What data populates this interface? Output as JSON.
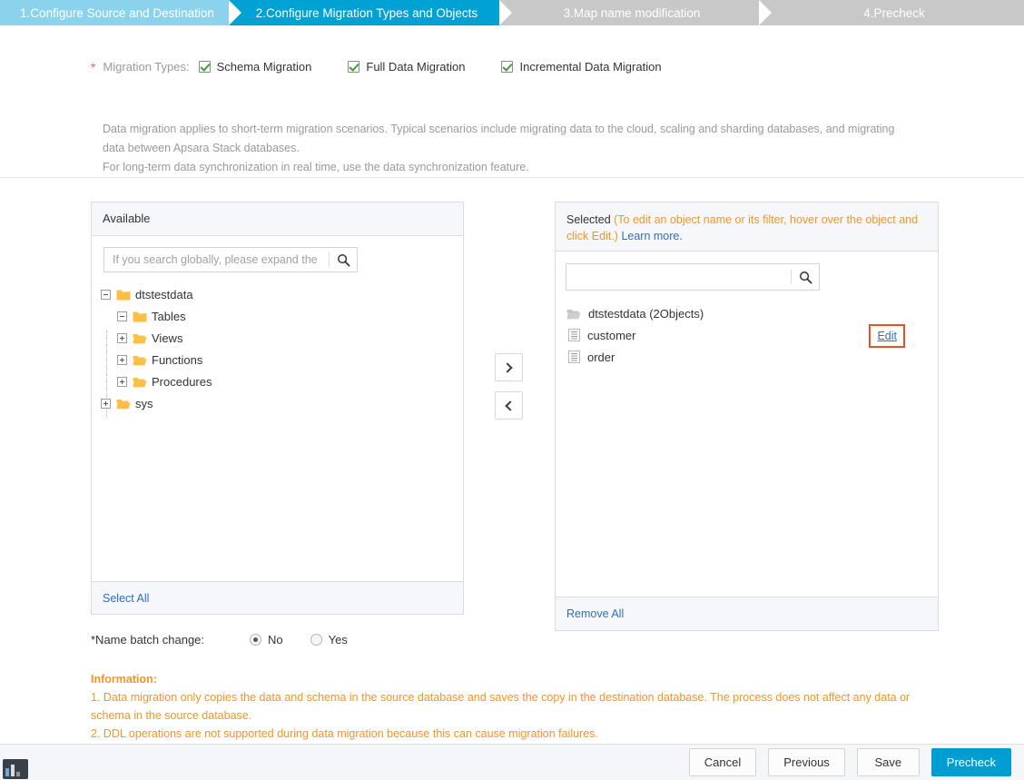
{
  "steps": [
    {
      "label": "1.Configure Source and Destination",
      "state": "done"
    },
    {
      "label": "2.Configure Migration Types and Objects",
      "state": "active"
    },
    {
      "label": "3.Map name modification",
      "state": "todo"
    },
    {
      "label": "4.Precheck",
      "state": "todo"
    }
  ],
  "migration": {
    "required_marker": "*",
    "label": "Migration Types:",
    "types": [
      {
        "label": "Schema Migration",
        "checked": true
      },
      {
        "label": "Full Data Migration",
        "checked": true
      },
      {
        "label": "Incremental Data Migration",
        "checked": true
      }
    ],
    "description_line1": "Data migration applies to short-term migration scenarios. Typical scenarios include migrating data to the cloud, scaling and sharding databases, and migrating data between Apsara Stack databases.",
    "description_line2": "For long-term data synchronization in real time, use the data synchronization feature."
  },
  "available": {
    "title": "Available",
    "search_placeholder": "If you search globally, please expand the ",
    "search_value": "",
    "search_icon": "search-icon",
    "tree": [
      {
        "label": "dtstestdata",
        "level": 1,
        "expanded": true,
        "toggle": "minus"
      },
      {
        "label": "Tables",
        "level": 2,
        "expanded": true,
        "toggle": "minus"
      },
      {
        "label": "Views",
        "level": 2,
        "expanded": false,
        "toggle": "plus"
      },
      {
        "label": "Functions",
        "level": 2,
        "expanded": false,
        "toggle": "plus"
      },
      {
        "label": "Procedures",
        "level": 2,
        "expanded": false,
        "toggle": "plus"
      },
      {
        "label": "sys",
        "level": 1,
        "expanded": false,
        "toggle": "plus"
      }
    ],
    "select_all": "Select All"
  },
  "transfer": {
    "move_right": "›",
    "move_left": "‹"
  },
  "selected": {
    "title": "Selected",
    "note": "(To edit an object name or its filter, hover over the object and click Edit.)",
    "learn_more": "Learn more.",
    "search_placeholder": "",
    "search_value": "",
    "search_icon": "search-icon",
    "items": [
      {
        "label": "dtstestdata (2Objects)",
        "icon": "folder-icon",
        "type": "group",
        "edit": null
      },
      {
        "label": "customer",
        "icon": "table-icon",
        "type": "object",
        "edit": "Edit"
      },
      {
        "label": "order",
        "icon": "table-icon",
        "type": "object",
        "edit": null
      }
    ],
    "remove_all": "Remove All",
    "highlight_color": "#e8512b"
  },
  "batch": {
    "label": "*Name batch change:",
    "options": [
      {
        "label": "No",
        "selected": true
      },
      {
        "label": "Yes",
        "selected": false
      }
    ]
  },
  "information": {
    "title": "Information:",
    "line1": "1. Data migration only copies the data and schema in the source database and saves the copy in the destination database. The process does not affect any data or schema in the source database.",
    "line2": "2. DDL operations are not supported during data migration because this can cause migration failures."
  },
  "footer": {
    "cancel": "Cancel",
    "previous": "Previous",
    "save": "Save",
    "precheck": "Precheck"
  },
  "colors": {
    "accent": "#009dd1",
    "step_done": "#8bd3ec",
    "step_todo": "#c8c8c8",
    "warning": "#f79521",
    "highlight": "#e8512b",
    "link": "#2f6fbb"
  }
}
